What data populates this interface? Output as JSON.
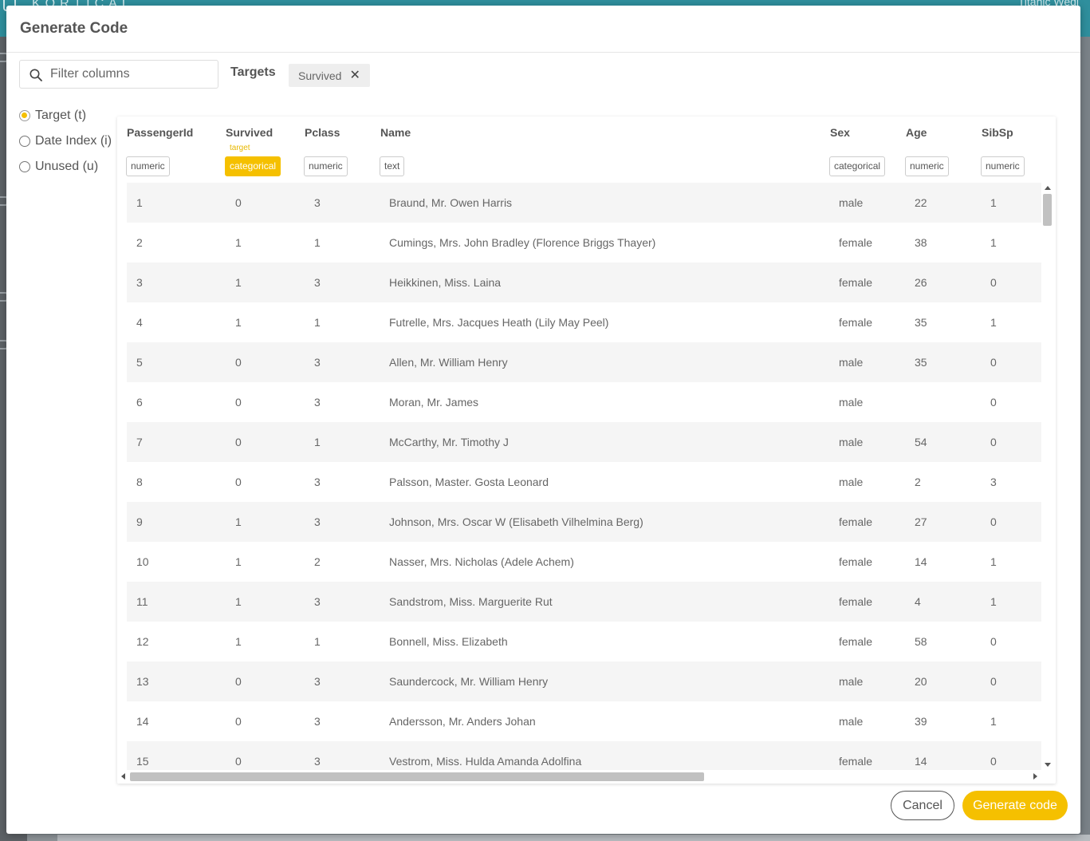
{
  "background": {
    "brand": "KORTICAL",
    "top_right_text": "Titanic Wedi"
  },
  "modal": {
    "title": "Generate Code"
  },
  "search": {
    "placeholder": "Filter columns",
    "value": ""
  },
  "targets": {
    "label": "Targets",
    "tags": [
      "Survived"
    ]
  },
  "column_roles": [
    {
      "label": "Target (t)",
      "selected": true
    },
    {
      "label": "Date Index (i)",
      "selected": false
    },
    {
      "label": "Unused (u)",
      "selected": false
    }
  ],
  "table": {
    "columns": [
      {
        "name": "PassengerId",
        "type": "numeric",
        "is_target": false,
        "target_hint": ""
      },
      {
        "name": "Survived",
        "type": "categorical",
        "is_target": true,
        "target_hint": "target"
      },
      {
        "name": "Pclass",
        "type": "numeric",
        "is_target": false,
        "target_hint": ""
      },
      {
        "name": "Name",
        "type": "text",
        "is_target": false,
        "target_hint": ""
      },
      {
        "name": "Sex",
        "type": "categorical",
        "is_target": false,
        "target_hint": ""
      },
      {
        "name": "Age",
        "type": "numeric",
        "is_target": false,
        "target_hint": ""
      },
      {
        "name": "SibSp",
        "type": "numeric",
        "is_target": false,
        "target_hint": ""
      }
    ],
    "rows": [
      [
        "1",
        "0",
        "3",
        "Braund, Mr. Owen Harris",
        "male",
        "22",
        "1"
      ],
      [
        "2",
        "1",
        "1",
        "Cumings, Mrs. John Bradley (Florence Briggs Thayer)",
        "female",
        "38",
        "1"
      ],
      [
        "3",
        "1",
        "3",
        "Heikkinen, Miss. Laina",
        "female",
        "26",
        "0"
      ],
      [
        "4",
        "1",
        "1",
        "Futrelle, Mrs. Jacques Heath (Lily May Peel)",
        "female",
        "35",
        "1"
      ],
      [
        "5",
        "0",
        "3",
        "Allen, Mr. William Henry",
        "male",
        "35",
        "0"
      ],
      [
        "6",
        "0",
        "3",
        "Moran, Mr. James",
        "male",
        "",
        "0"
      ],
      [
        "7",
        "0",
        "1",
        "McCarthy, Mr. Timothy J",
        "male",
        "54",
        "0"
      ],
      [
        "8",
        "0",
        "3",
        "Palsson, Master. Gosta Leonard",
        "male",
        "2",
        "3"
      ],
      [
        "9",
        "1",
        "3",
        "Johnson, Mrs. Oscar W (Elisabeth Vilhelmina Berg)",
        "female",
        "27",
        "0"
      ],
      [
        "10",
        "1",
        "2",
        "Nasser, Mrs. Nicholas (Adele Achem)",
        "female",
        "14",
        "1"
      ],
      [
        "11",
        "1",
        "3",
        "Sandstrom, Miss. Marguerite Rut",
        "female",
        "4",
        "1"
      ],
      [
        "12",
        "1",
        "1",
        "Bonnell, Miss. Elizabeth",
        "female",
        "58",
        "0"
      ],
      [
        "13",
        "0",
        "3",
        "Saundercock, Mr. William Henry",
        "male",
        "20",
        "0"
      ],
      [
        "14",
        "0",
        "3",
        "Andersson, Mr. Anders Johan",
        "male",
        "39",
        "1"
      ],
      [
        "15",
        "0",
        "3",
        "Vestrom, Miss. Hulda Amanda Adolfina",
        "female",
        "14",
        "0"
      ]
    ]
  },
  "footer": {
    "cancel_label": "Cancel",
    "generate_label": "Generate code"
  },
  "colors": {
    "accent": "#f5c000",
    "header_bar": "#2f8f9d"
  }
}
